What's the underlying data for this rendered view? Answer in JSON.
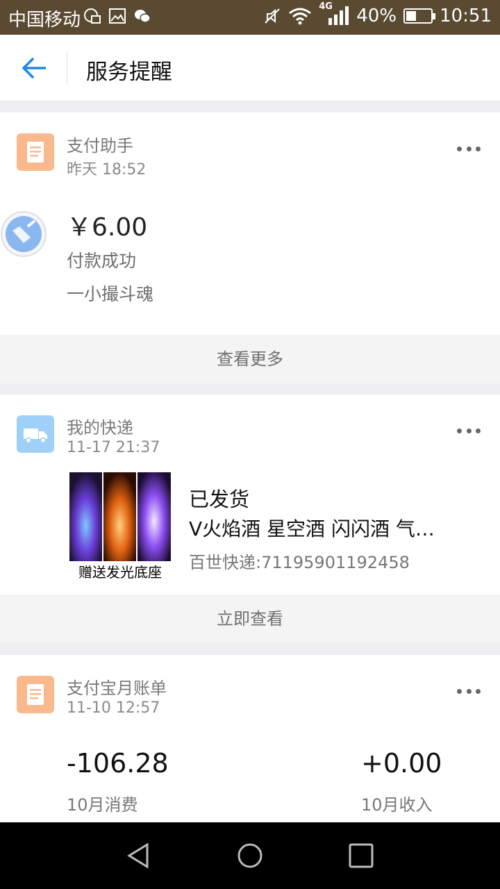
{
  "status_bar": {
    "carrier": "中国移动",
    "network": "4G",
    "battery": "40%",
    "battery_level": 0.4,
    "time": "10:51"
  },
  "header": {
    "title": "服务提醒"
  },
  "cards": [
    {
      "app_name": "支付助手",
      "time": "昨天 18:52",
      "icon": "document-icon",
      "icon_color": "#f9b98c",
      "amount": "￥6.00",
      "status": "付款成功",
      "merchant": "一小撮斗魂",
      "footer": "查看更多"
    },
    {
      "app_name": "我的快递",
      "time": "11-17 21:37",
      "icon": "truck-icon",
      "icon_color": "#9fd0f7",
      "heading": "已发货",
      "product": "V火焰酒 星空酒 闪闪酒 气…",
      "tracking": "百世快递:71195901192458",
      "image_caption": "赠送发光底座",
      "footer": "立即查看"
    },
    {
      "app_name": "支付宝月账单",
      "time": "11-10 12:57",
      "icon": "document-icon",
      "icon_color": "#f9b98c",
      "spend_value": "-106.28",
      "spend_label": "10月消费",
      "income_value": "+0.00",
      "income_label": "10月收入"
    }
  ]
}
